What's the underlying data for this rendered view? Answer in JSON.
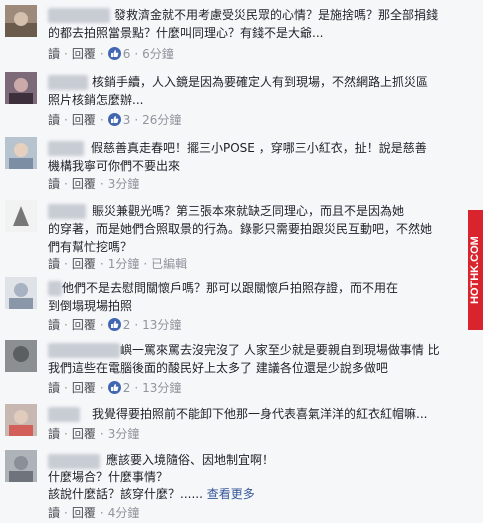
{
  "comments": [
    {
      "text_lines": [
        "發救濟金就不用考慮受災民眾的心情？是施捨嗎？那全部捐錢",
        "的都去拍照當景點？什麼叫同理心？有錢不是大爺..."
      ],
      "reply": "讀",
      "reply2": "回覆",
      "likes": "6",
      "time": "6分鐘"
    },
    {
      "text_lines": [
        "核銷手續，人入鏡是因為要確定人有到現場，不然網路上抓災區",
        "照片核銷怎麼辦..."
      ],
      "reply": "讀",
      "reply2": "回覆",
      "likes": "3",
      "time": "26分鐘"
    },
    {
      "text_lines": [
        "假慈善真走春吧！擺三小POSE ，穿哪三小紅衣，扯！說是慈善",
        "機構我寧可你們不要出來"
      ],
      "reply": "讀",
      "reply2": "回覆",
      "time": "3分鐘"
    },
    {
      "text_lines": [
        "賑災兼觀光嗎？第三張本來就缺乏同理心，而且不是因為她",
        "的穿著，而是她們合照取景的行為。錄影只需要拍跟災民互動吧，不然她",
        "們有幫忙挖嗎？"
      ],
      "reply": "讀",
      "reply2": "回覆",
      "time": "1分鐘",
      "edited": "已編輯"
    },
    {
      "text_lines": [
        "他們不是去慰問關懷戶嗎？那可以跟關懷戶拍照存證，而不用在",
        "到倒塌現場拍照"
      ],
      "reply": "讀",
      "reply2": "回覆",
      "likes": "2",
      "time": "13分鐘"
    },
    {
      "text_lines": [
        "嶼一罵來罵去沒完沒了 人家至少就是要親自到現場做事情 比",
        "我們這些在電腦後面的酸民好上太多了 建議各位還是少說多做吧"
      ],
      "reply": "讀",
      "reply2": "回覆",
      "likes": "2",
      "time": "13分鐘"
    },
    {
      "text_lines": [
        "我覺得要拍照前不能卸下他那一身代表喜氣洋洋的紅衣紅帽嘛..."
      ],
      "reply": "讀",
      "reply2": "回覆",
      "time": "3分鐘"
    },
    {
      "text_lines": [
        "應該要入境隨俗、因地制宜啊！",
        "什麼場合？什麼事情？",
        "該說什麼話？該穿什麼？......"
      ],
      "see_more": "查看更多",
      "reply": "讀",
      "reply2": "回覆",
      "time": "4分鐘"
    }
  ],
  "watermark": "HOTHK.COM",
  "colors": {
    "accent": "#4267b2",
    "meta": "#90949c",
    "ad": "#d9242d"
  }
}
